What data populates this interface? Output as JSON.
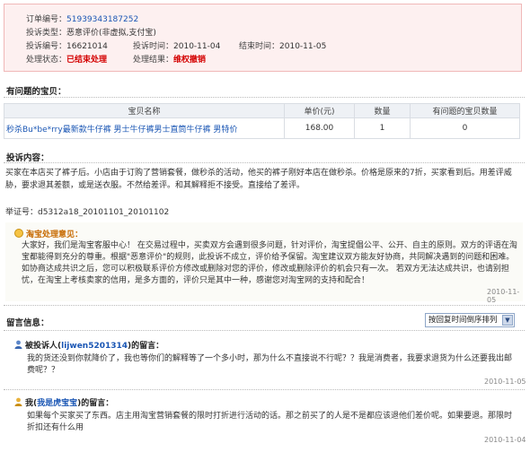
{
  "order": {
    "order_no_label": "订单编号：",
    "order_no": "51939343187252",
    "type_label": "投诉类型：",
    "type": "恶意评价(非虚拟,支付宝)",
    "complaint_no_label": "投诉编号：",
    "complaint_no": "16621014",
    "complaint_time_label": "投诉时间：",
    "complaint_time": "2010-11-04",
    "end_time_label": "结束时间：",
    "end_time": "2010-11-05",
    "status_label": "处理状态：",
    "status": "已结束处理",
    "result_label": "处理结果：",
    "result": "维权撤销"
  },
  "products": {
    "title": "有问题的宝贝：",
    "headers": [
      "宝贝名称",
      "单价(元)",
      "数量",
      "有问题的宝贝数量"
    ],
    "rows": [
      {
        "name": "秒杀Bu*be*rry最新款牛仔裤 男士牛仔裤男士直筒牛仔裤 男特价",
        "price": "168.00",
        "qty": "1",
        "problem_qty": "0"
      }
    ]
  },
  "complaint": {
    "title": "投诉内容：",
    "text": "买家在本店买了裤子后。小店由于订购了营销套餐，做秒杀的活动，他买的裤子刚好本店在做秒杀。价格是原来的7折，买家看到后。用差评威胁，要求退其差额，或是送衣服。不然给差评。和其解释拒不接受。直接给了差评。",
    "evidence": "举证号：d5312a18_20101101_20101102"
  },
  "opinion": {
    "title": "淘宝处理意见：",
    "text": "大家好，我们是淘宝客服中心！ 在交易过程中，买卖双方会遇到很多问题，针对评价，淘宝提倡公平、公开、自主的原则。双方的评语在淘宝都能得到充分的尊重。根据\"恶意评价\"的规则，此投诉不成立，评价给予保留。淘宝建议双方能友好协商，共同解决遇到的问题和困难。 如协商达成共识之后，您可以积极联系评价方修改或删除对您的评价，修改或删除评价的机会只有一次。 若双方无法达成共识，也请别担忧，在淘宝上考核卖家的信用，是多方面的，评价只是其中一种，感谢您对淘宝网的支持和配合！",
    "date": "2010-11-05"
  },
  "messages": {
    "title": "留言信息：",
    "sort_option": "按回复时间倒序排列",
    "items": [
      {
        "prefix": "被投诉人(",
        "user": "lijwen5201314",
        "suffix": ")的留言：",
        "text": "我的货还没到你就降价了，我也等你们的解释等了一个多小时，那为什么不直接说不行呢？？我是消费者，我要求退货为什么还要我出邮费呢？？",
        "date": "2010-11-05"
      },
      {
        "prefix": "我(",
        "user": "我是虎宝宝",
        "suffix": ")的留言：",
        "text": "如果每个买家买了东西。店主用淘宝营销套餐的限时打折进行活动的话。那之前买了的人是不是都应该退他们差价呢。如果要退。那限时折扣还有什么用",
        "date": "2010-11-04"
      }
    ]
  },
  "colors": {
    "status_red": "#d40000",
    "link_blue": "#1a56b4",
    "box_pink": "#fdf0f0",
    "opinion_orange": "#c76a00"
  }
}
